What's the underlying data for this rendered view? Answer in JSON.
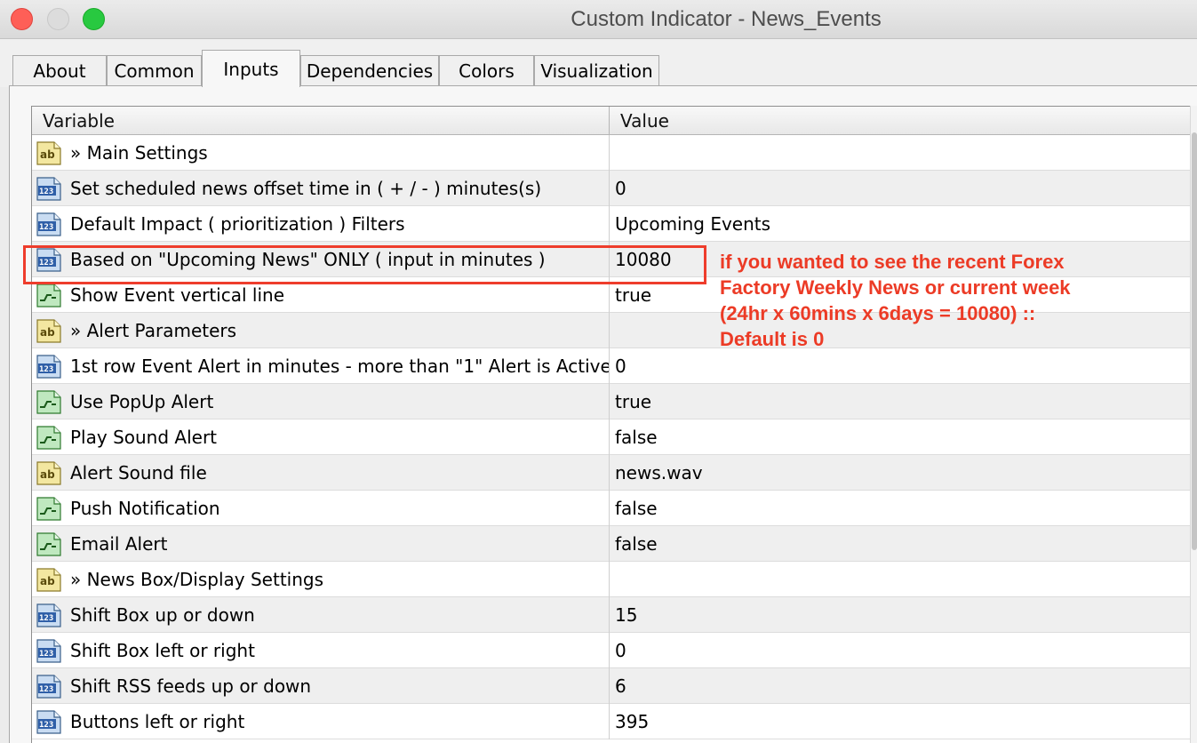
{
  "window": {
    "title": "Custom Indicator - News_Events"
  },
  "tabs": [
    {
      "label": "About",
      "active": false
    },
    {
      "label": "Common",
      "active": false
    },
    {
      "label": "Inputs",
      "active": true
    },
    {
      "label": "Dependencies",
      "active": false
    },
    {
      "label": "Colors",
      "active": false
    },
    {
      "label": "Visualization",
      "active": false
    }
  ],
  "table": {
    "headers": {
      "variable": "Variable",
      "value": "Value"
    },
    "rows": [
      {
        "type": "string",
        "icon": "ab-string-icon",
        "variable": "» Main Settings",
        "value": ""
      },
      {
        "type": "number",
        "icon": "123-number-icon",
        "variable": "Set scheduled news offset time in ( + / - ) minutes(s)",
        "value": "0"
      },
      {
        "type": "number",
        "icon": "123-number-icon",
        "variable": "Default Impact ( prioritization ) Filters",
        "value": "Upcoming Events"
      },
      {
        "type": "number",
        "icon": "123-number-icon",
        "variable": "Based on \"Upcoming News\" ONLY ( input in minutes )",
        "value": "10080"
      },
      {
        "type": "bool",
        "icon": "bool-toggle-icon",
        "variable": "Show Event vertical line",
        "value": "true"
      },
      {
        "type": "string",
        "icon": "ab-string-icon",
        "variable": "» Alert Parameters",
        "value": ""
      },
      {
        "type": "number",
        "icon": "123-number-icon",
        "variable": "1st row Event Alert in minutes - more than \"1\" Alert is Active",
        "value": "0"
      },
      {
        "type": "bool",
        "icon": "bool-toggle-icon",
        "variable": "Use PopUp Alert",
        "value": "true"
      },
      {
        "type": "bool",
        "icon": "bool-toggle-icon",
        "variable": "Play Sound Alert",
        "value": "false"
      },
      {
        "type": "string",
        "icon": "ab-string-icon",
        "variable": "Alert Sound file",
        "value": "news.wav"
      },
      {
        "type": "bool",
        "icon": "bool-toggle-icon",
        "variable": "Push Notification",
        "value": "false"
      },
      {
        "type": "bool",
        "icon": "bool-toggle-icon",
        "variable": "Email Alert",
        "value": "false"
      },
      {
        "type": "string",
        "icon": "ab-string-icon",
        "variable": "» News Box/Display Settings",
        "value": ""
      },
      {
        "type": "number",
        "icon": "123-number-icon",
        "variable": "Shift Box up or down",
        "value": "15"
      },
      {
        "type": "number",
        "icon": "123-number-icon",
        "variable": "Shift Box left or right",
        "value": "0"
      },
      {
        "type": "number",
        "icon": "123-number-icon",
        "variable": "Shift RSS feeds up or down",
        "value": "6"
      },
      {
        "type": "number",
        "icon": "123-number-icon",
        "variable": "Buttons left or right",
        "value": "395"
      }
    ]
  },
  "annotation": {
    "lines": [
      "if you wanted to see the recent Forex",
      "Factory  Weekly News or current week",
      "(24hr x 60mins x 6days = 10080) ::",
      "Default is 0"
    ],
    "color": "#ec3b26"
  },
  "icon_labels": {
    "string": "ab",
    "number": "123"
  },
  "colors": {
    "traffic_close": "#fe5f57",
    "traffic_minimize": "#dcdcdc",
    "traffic_zoom": "#28c940",
    "highlight_box": "#ee3d2c"
  }
}
